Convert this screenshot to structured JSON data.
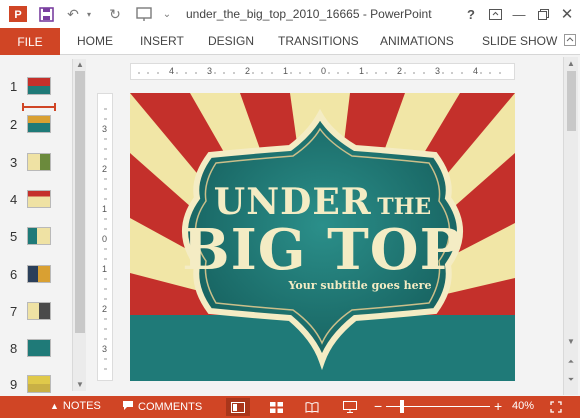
{
  "titlebar": {
    "doc_title": "under_the_big_top_2010_16665 - PowerPoint",
    "help": "?"
  },
  "ribbon": {
    "tabs": [
      "FILE",
      "HOME",
      "INSERT",
      "DESIGN",
      "TRANSITIONS",
      "ANIMATIONS",
      "SLIDE SHOW"
    ]
  },
  "thumbnails": {
    "numbers": [
      "1",
      "2",
      "3",
      "4",
      "5",
      "6",
      "7",
      "8",
      "9"
    ],
    "selected": "1"
  },
  "ruler": {
    "h_labels": [
      "4",
      "3",
      "2",
      "1",
      "0",
      "1",
      "2",
      "3",
      "4"
    ],
    "v_labels": [
      "3",
      "2",
      "1",
      "0",
      "1",
      "2",
      "3"
    ]
  },
  "slide": {
    "line1_a": "UNDER",
    "line1_b": "THE",
    "line2": "BIG TOP",
    "subtitle": "Your subtitle goes here"
  },
  "status": {
    "notes": "NOTES",
    "comments": "COMMENTS",
    "zoom_minus": "−",
    "zoom_plus": "+",
    "zoom": "40%"
  },
  "colors": {
    "accent": "#d04525",
    "teal": "#1f7a78",
    "cream": "#f4ecc4",
    "red_ray": "#c4302b"
  }
}
